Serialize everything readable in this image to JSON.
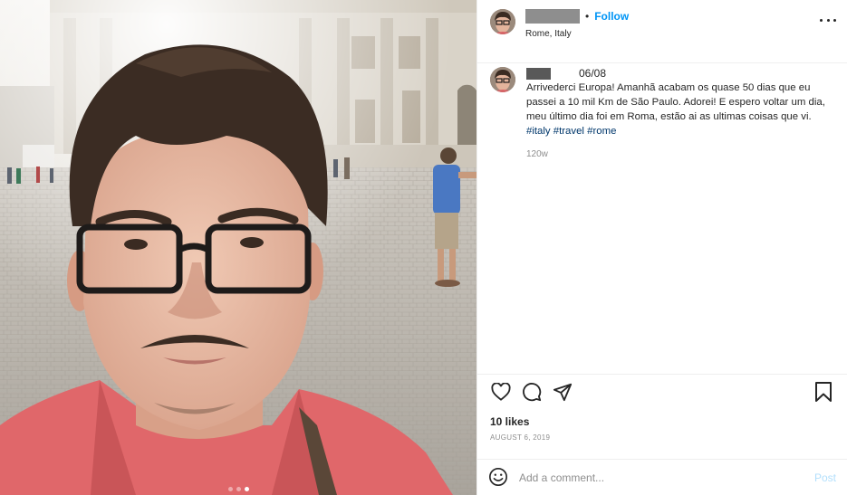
{
  "header": {
    "follow_label": "Follow",
    "location": "Rome, Italy"
  },
  "caption": {
    "date": "06/08",
    "text": "Arrivederci Europa! Amanhã acabam os quase 50 dias que eu passei a 10 mil Km de São Paulo. Adorei! E espero voltar um dia, meu último dia foi em Roma, estão ai as ultimas coisas que vi.",
    "hashtags": [
      "#italy",
      "#travel",
      "#rome"
    ],
    "time_ago": "120w"
  },
  "engagement": {
    "likes": "10 likes",
    "posted_date": "AUGUST 6, 2019"
  },
  "comment_box": {
    "placeholder": "Add a comment...",
    "post_label": "Post"
  },
  "carousel": {
    "count": 3,
    "active_index": 2
  },
  "icons": {
    "like": "heart-icon",
    "comment": "comment-bubble-icon",
    "share": "paper-plane-icon",
    "save": "bookmark-icon",
    "emoji": "emoji-icon",
    "more": "more-options-icon"
  },
  "colors": {
    "follow_blue": "#0095f6",
    "hashtag_blue": "#00376b",
    "muted_gray": "#8e8e8e",
    "post_button": "#b2dffc",
    "shirt_red": "#e0676a"
  }
}
